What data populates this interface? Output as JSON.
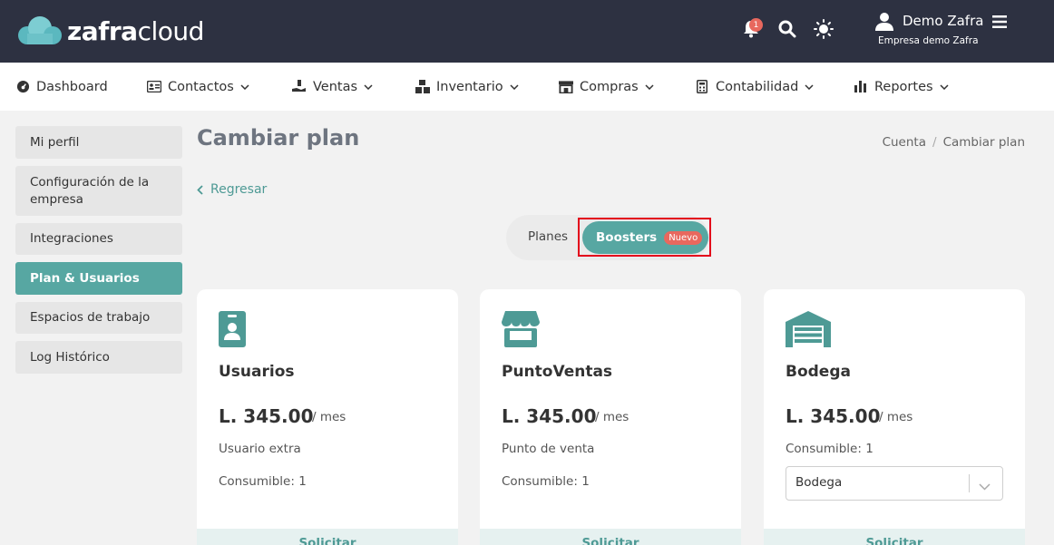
{
  "header": {
    "logo_bold": "zafra",
    "logo_light": "cloud",
    "notification_count": "1",
    "user_name": "Demo Zafra",
    "company": "Empresa demo Zafra"
  },
  "nav": {
    "items": [
      {
        "label": "Dashboard",
        "icon": "dashboard-icon"
      },
      {
        "label": "Contactos",
        "icon": "contact-card-icon"
      },
      {
        "label": "Ventas",
        "icon": "hand-money-icon"
      },
      {
        "label": "Inventario",
        "icon": "boxes-icon"
      },
      {
        "label": "Compras",
        "icon": "store-icon"
      },
      {
        "label": "Contabilidad",
        "icon": "calculator-icon"
      },
      {
        "label": "Reportes",
        "icon": "bar-chart-icon"
      }
    ]
  },
  "sidebar": {
    "items": [
      {
        "label": "Mi perfil"
      },
      {
        "label": "Configuración de la empresa"
      },
      {
        "label": "Integraciones"
      },
      {
        "label": "Plan & Usuarios",
        "active": true
      },
      {
        "label": "Espacios de trabajo"
      },
      {
        "label": "Log Histórico"
      }
    ]
  },
  "page": {
    "title": "Cambiar plan",
    "breadcrumb": [
      "Cuenta",
      "Cambiar plan"
    ],
    "back_label": "Regresar"
  },
  "toggle": {
    "planes": "Planes",
    "boosters": "Boosters",
    "boosters_badge": "Nuevo"
  },
  "cards": [
    {
      "title": "Usuarios",
      "price": "L. 345.00",
      "period": "/ mes",
      "line1": "Usuario extra",
      "line2": "Consumible: 1",
      "action": "Solicitar",
      "icon": "id-badge-icon"
    },
    {
      "title": "PuntoVentas",
      "price": "L. 345.00",
      "period": "/ mes",
      "line1": "Punto de venta",
      "line2": "Consumible: 1",
      "action": "Solicitar",
      "icon": "storefront-icon"
    },
    {
      "title": "Bodega",
      "price": "L. 345.00",
      "period": "/ mes",
      "line1": "Consumible: 1",
      "select_value": "Bodega",
      "action": "Solicitar",
      "icon": "warehouse-icon"
    }
  ],
  "colors": {
    "topbar": "#2d3141",
    "accent": "#57a7a2",
    "badge": "#e8685e",
    "highlight": "#e3001b"
  }
}
